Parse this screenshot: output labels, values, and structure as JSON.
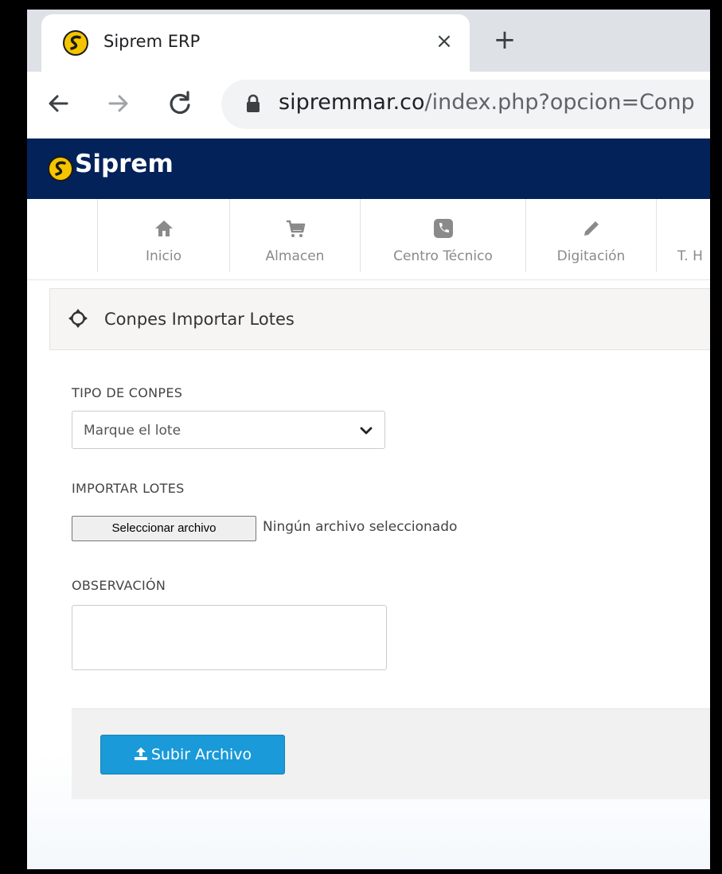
{
  "browser": {
    "tab_title": "Siprem ERP",
    "close_glyph": "×",
    "new_tab_glyph": "+",
    "url_host": "sipremmar.co",
    "url_path": "/index.php?opcion=Conp"
  },
  "app": {
    "brand": "Siprem",
    "header_color": "#03225a"
  },
  "module_nav": [
    {
      "label": "Inicio",
      "icon": "home-icon"
    },
    {
      "label": "Almacen",
      "icon": "cart-icon"
    },
    {
      "label": "Centro Técnico",
      "icon": "phone-icon"
    },
    {
      "label": "Digitación",
      "icon": "pencil-icon"
    },
    {
      "label": "T. H",
      "icon": "user-icon"
    }
  ],
  "section": {
    "title": "Conpes Importar Lotes",
    "icon": "crosshair-icon"
  },
  "form": {
    "tipo_label": "TIPO DE CONPES",
    "tipo_selected": "Marque el lote",
    "importar_label": "IMPORTAR LOTES",
    "file_button": "Seleccionar archivo",
    "file_status": "Ningún archivo seleccionado",
    "observacion_label": "OBSERVACIÓN",
    "observacion_value": "",
    "submit_label": "Subir Archivo",
    "submit_color": "#1a9ad8"
  }
}
